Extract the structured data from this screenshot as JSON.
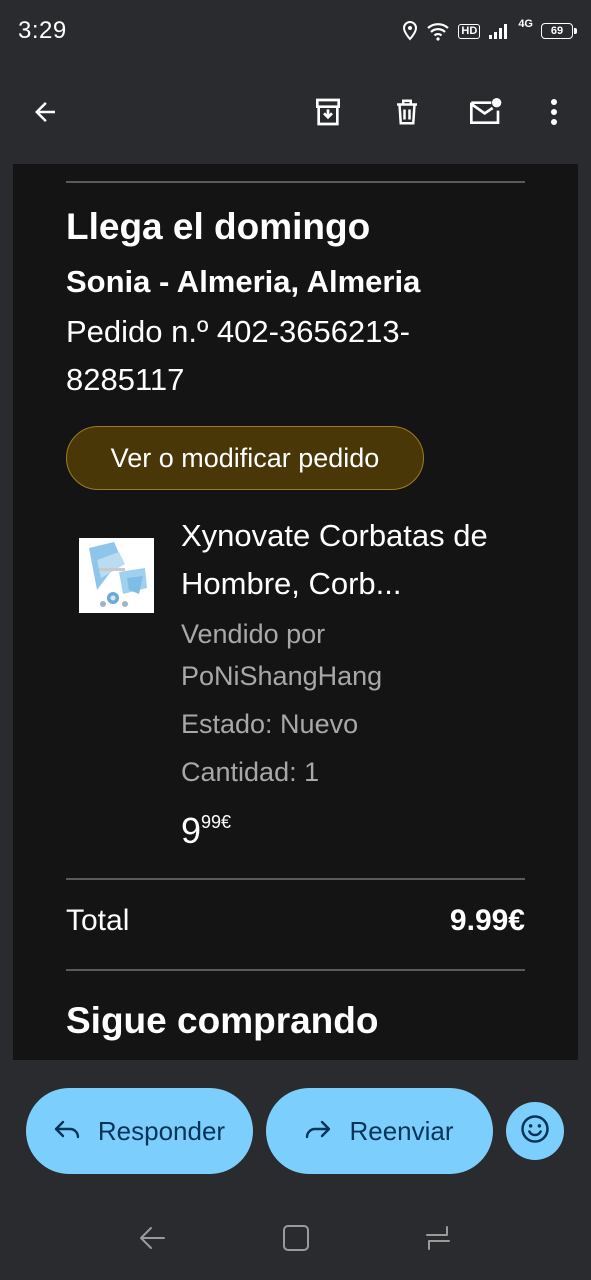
{
  "status_bar": {
    "time": "3:29",
    "hd_label": "HD",
    "network_label": "4G",
    "battery": "69",
    "icons": [
      "location-icon",
      "wifi-icon",
      "signal-icon",
      "battery-icon"
    ]
  },
  "app_bar": {
    "icons": [
      "back-arrow-icon",
      "archive-icon",
      "delete-icon",
      "mark-unread-icon",
      "more-vert-icon"
    ]
  },
  "email": {
    "arrival_heading": "Llega el domingo",
    "recipient": "Sonia - Almeria, Almeria",
    "order_number_line1": "Pedido n.º 402-3656213-",
    "order_number_line2": "8285117",
    "order_button": "Ver o modificar pedido",
    "product": {
      "title_line1": "Xynovate Corbatas de",
      "title_line2": "Hombre, Corb...",
      "seller_line1": "Vendido por",
      "seller_line2": "PoNiShangHang",
      "condition": "Estado: Nuevo",
      "quantity": "Cantidad: 1",
      "price_whole": "9",
      "price_fraction": "99€"
    },
    "total_label": "Total",
    "total_value": "9.99€",
    "keep_shopping": "Sigue comprando"
  },
  "actions": {
    "reply": "Responder",
    "forward": "Reenviar"
  },
  "colors": {
    "background": "#292b2e",
    "email_bg": "#141414",
    "button_blue": "#7ccffd",
    "order_button_bg": "#4a3708",
    "order_button_border": "#9c7d1f",
    "muted_text": "#a8a8a8"
  }
}
